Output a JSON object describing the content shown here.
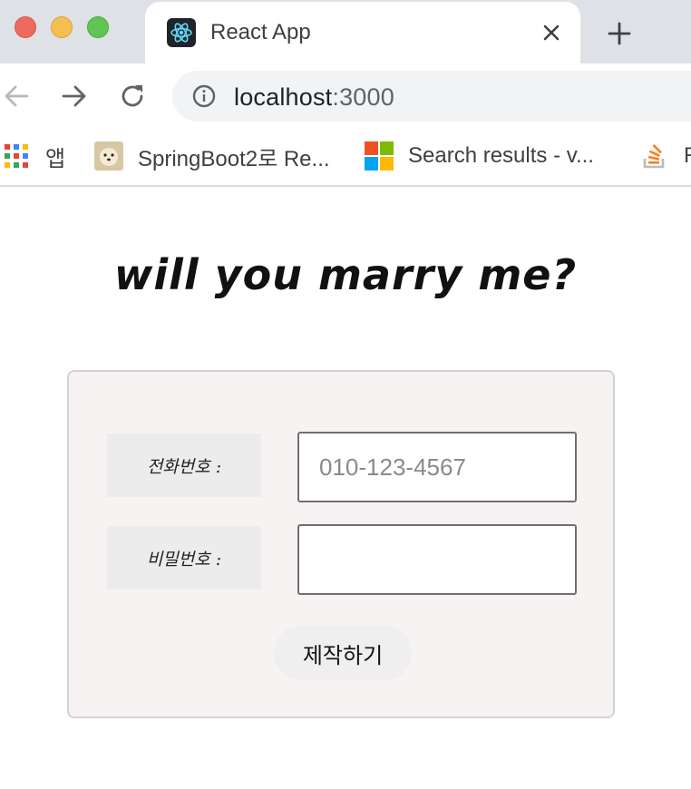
{
  "browser": {
    "tab": {
      "title": "React App",
      "favicon": "react-logo-icon"
    },
    "new_tab_icon": "plus-icon",
    "address": {
      "host": "localhost",
      "port": ":3000"
    },
    "bookmarks": [
      {
        "label": "앱",
        "icon": "apps-grid-icon"
      },
      {
        "label": "SpringBoot2로 Re...",
        "icon": "puppy-avatar-icon"
      },
      {
        "label": "Search results - v...",
        "icon": "microsoft-logo-icon"
      },
      {
        "label": "R",
        "icon": "stackoverflow-icon"
      }
    ]
  },
  "page": {
    "heading": "will you marry me?",
    "form": {
      "phone_label": "전화번호 :",
      "phone_placeholder": "010-123-4567",
      "phone_value": "",
      "password_label": "비밀번호 :",
      "password_value": "",
      "submit_label": "제작하기"
    }
  },
  "colors": {
    "tabstrip": "#dee1e6",
    "card_background": "#f8f3f3",
    "label_background": "#ececec",
    "button_background": "#efefef"
  }
}
